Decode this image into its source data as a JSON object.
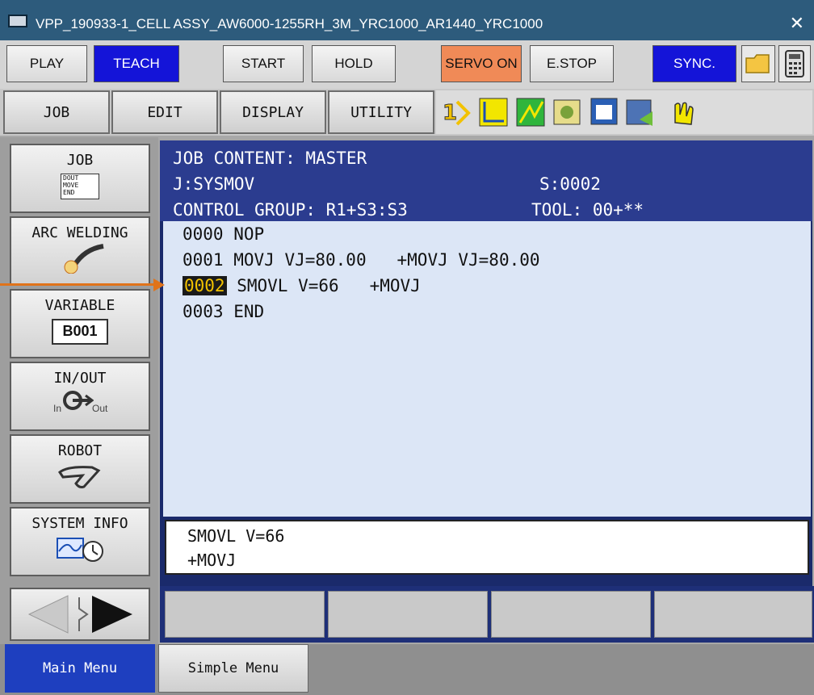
{
  "window": {
    "title": "VPP_190933-1_CELL ASSY_AW6000-1255RH_3M_YRC1000_AR1440_YRC1000",
    "close_symbol": "✕"
  },
  "toolbar": {
    "play": "PLAY",
    "teach": "TEACH",
    "start": "START",
    "hold": "HOLD",
    "servo_on": "SERVO ON",
    "estop": "E.STOP",
    "sync": "SYNC."
  },
  "menu": {
    "job": "JOB",
    "edit": "EDIT",
    "display": "DISPLAY",
    "utility": "UTILITY"
  },
  "left_menu": {
    "job": "JOB",
    "job_icon_text": [
      "DOUT",
      "MOVE",
      "END"
    ],
    "arc_welding": "ARC WELDING",
    "variable": "VARIABLE",
    "variable_value": "B001",
    "inout": "IN/OUT",
    "inout_in": "In",
    "inout_out": "Out",
    "robot": "ROBOT",
    "system_info": "SYSTEM INFO"
  },
  "job_header": {
    "title": "JOB CONTENT: MASTER",
    "job": "J:SYSMOV",
    "step": "S:0002",
    "control_group": "CONTROL GROUP: R1+S3:S3",
    "tool": "TOOL: 00+**"
  },
  "job_lines": [
    {
      "num": "0000",
      "text": "NOP"
    },
    {
      "num": "0001",
      "text": "MOVJ VJ=80.00   +MOVJ VJ=80.00"
    },
    {
      "num": "0002",
      "text": "SMOVL V=66   +MOVJ"
    },
    {
      "num": "0003",
      "text": "END"
    }
  ],
  "edit_line": {
    "line1": "SMOVL V=66",
    "line2": "+MOVJ"
  },
  "footer": {
    "main_menu": "Main Menu",
    "simple_menu": "Simple Menu"
  },
  "colors": {
    "servo_on": "#f08a57",
    "teach": "#1414d8",
    "sync": "#1414d8",
    "main_menu": "#1e3fbf",
    "cursor": "#f2c200"
  }
}
